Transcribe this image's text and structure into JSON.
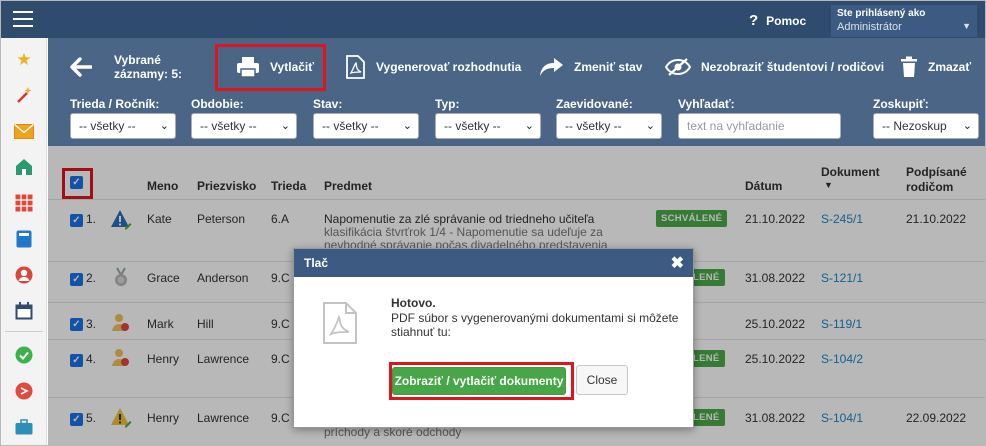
{
  "header": {
    "help_label": "Pomoc",
    "user_line1": "Ste prihlásený ako",
    "user_line2": "Administrátor"
  },
  "actions": {
    "selected_line1": "Vybrané",
    "selected_line2": "záznamy: 5:",
    "print": "Vytlačiť",
    "generate": "Vygenerovať rozhodnutia",
    "change_state": "Zmeniť stav",
    "hide": "Nezobraziť študentovi / rodičovi",
    "delete": "Zmazať"
  },
  "filters": {
    "class_label": "Trieda / Ročník:",
    "class_value": "-- všetky --",
    "period_label": "Obdobie:",
    "period_value": "-- všetky --",
    "state_label": "Stav:",
    "state_value": "-- všetky --",
    "type_label": "Typ:",
    "type_value": "-- všetky --",
    "registered_label": "Zaevidované:",
    "registered_value": "-- všetky --",
    "search_label": "Vyhľadať:",
    "search_placeholder": "text na vyhľadanie",
    "group_label": "Zoskupiť:",
    "group_value": "-- Nezoskup"
  },
  "table": {
    "headers": {
      "name": "Meno",
      "surname": "Priezvisko",
      "class": "Trieda",
      "subject": "Predmet",
      "date": "Dátum",
      "document": "Dokument",
      "signed_line1": "Podpísané",
      "signed_line2": "rodičom"
    },
    "rows": [
      {
        "num": "1.",
        "name": "Kate",
        "surname": "Peterson",
        "class": "6.A",
        "subject": "Napomenutie za zlé správanie od triedneho učiteľa",
        "subject_sub1": "klasifikácia štvrťrok 1/4 - Napomenutie sa udeľuje za",
        "subject_sub2": "nevhodné správanie počas divadelného predstavenia",
        "status": "SCHVÁLENÉ",
        "date": "21.10.2022",
        "document": "S-245/1",
        "signed": "21.10.2022"
      },
      {
        "num": "2.",
        "name": "Grace",
        "surname": "Anderson",
        "class": "9.C",
        "status": "LENÉ",
        "date": "31.08.2022",
        "document": "S-121/1",
        "signed": ""
      },
      {
        "num": "3.",
        "name": "Mark",
        "surname": "Hill",
        "class": "9.C",
        "status": "",
        "date": "25.10.2022",
        "document": "S-119/1",
        "signed": ""
      },
      {
        "num": "4.",
        "name": "Henry",
        "surname": "Lawrence",
        "class": "9.C",
        "status": "LENÉ",
        "date": "25.10.2022",
        "document": "S-104/2",
        "signed": ""
      },
      {
        "num": "5.",
        "name": "Henry",
        "surname": "Lawrence",
        "class": "9.C",
        "subject_sub1": "príchody a skoré odchody",
        "status": "LENÉ",
        "date": "31.08.2022",
        "document": "S-104/1",
        "signed": "22.09.2022"
      }
    ]
  },
  "modal": {
    "title": "Tlač",
    "heading": "Hotovo.",
    "text": "PDF súbor s vygenerovanými dokumentami si môžete stiahnuť tu:",
    "primary_button": "Zobraziť / vytlačiť dokumenty",
    "close_button": "Close"
  },
  "colors": {
    "topbar": "#2f4b6e",
    "actionbar": "#4a6586",
    "highlight": "#e0141e",
    "approved": "#4caa4a",
    "link": "#1d86c8"
  }
}
